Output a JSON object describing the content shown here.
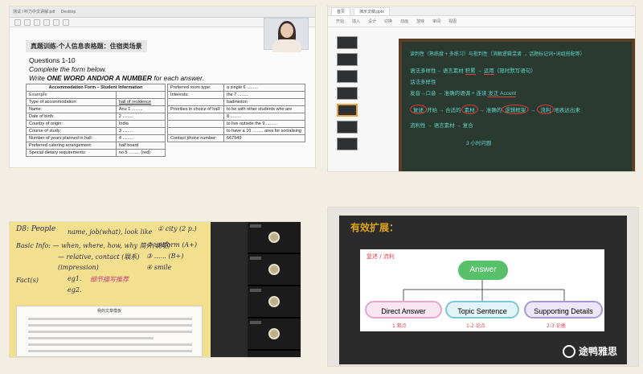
{
  "panel_doc": {
    "tabs": [
      "测试 I 听力中文讲解.pdf",
      "Desktop"
    ],
    "banner": "真题训练-个人信息表格题：住宿类场景",
    "q1": "Questions 1-10",
    "q2": "Complete the form below.",
    "q3_a": "Write ",
    "q3_b": "ONE WORD AND/OR A NUMBER",
    "q3_c": " for each answer.",
    "left_table": {
      "header": "Accommodation Form – Student Information",
      "rows": [
        [
          "Example",
          ""
        ],
        [
          "Type of accommodation:",
          "hall of residence"
        ],
        [
          "Name:",
          "Anu 1 ........."
        ],
        [
          "Date of birth:",
          "2 ........."
        ],
        [
          "Country of origin:",
          "India"
        ],
        [
          "Course of study:",
          "3 ........."
        ],
        [
          "Number of years planned in hall:",
          "4 ........."
        ],
        [
          "Preferred catering arrangement:",
          "half board"
        ],
        [
          "Special dietary requirements:",
          "no 5 ......... (red)"
        ]
      ]
    },
    "right_table": {
      "rows": [
        [
          "Preferred room type:",
          "a single 6 ........."
        ],
        [
          "Interests:",
          "the 7 ........."
        ],
        [
          "",
          "badminton"
        ],
        [
          "Priorities in choice of hall:",
          "to be with other students who are"
        ],
        [
          "",
          "8 ........."
        ],
        [
          "",
          "to live outside the 9 ........."
        ],
        [
          "",
          "to have a 10 ......... area for socialising"
        ],
        [
          "Contact   phone number:",
          "667549"
        ]
      ]
    }
  },
  "panel_slides": {
    "tabs": [
      "首页",
      "演示文稿.pptx"
    ],
    "ribbon": [
      "开始",
      "插入",
      "设计",
      "切换",
      "动画",
      "放映",
      "审阅",
      "视图"
    ],
    "lines": {
      "l1": "读判性（熟练度 + 多练习）与批判性（消解逻辑混淆 → 话题标记词+词组搭配等）",
      "l2a": "语法多样性",
      "l2b": "→ 语言素材 ",
      "l2c": "积累",
      "l2d": " → ",
      "l2e": "运用",
      "l2f": "（限时默写语句）",
      "l3": "话法多样性",
      "l4a": "发音→口音 → 准确的语调 + 连读",
      "l4b": " 发正 Accent",
      "c1": "复述",
      "c2": "开始 → 合适的",
      "c3": "素材",
      "c4": " → 准确的",
      "c5": "逻辑框架",
      "c6": " → ",
      "c7": "流利",
      "c8": "地表达出来",
      "l6": "流利性 → 语言素材 → 复合",
      "l7": "3 小时问题"
    }
  },
  "panel_notes": {
    "lines": {
      "a": "D8: People",
      "b": "name, job(what), look like",
      "c": "Basic Info: — when, where, how, why 简介(说明)",
      "d": "— relative, contact (联系)",
      "e": "(impression)",
      "f": "Fact(s)",
      "g": "eg1.",
      "h": "细节描写推荐",
      "i": "eg2.",
      "r1": "① city (2 p.)",
      "r2": "② uniform (A+)",
      "r3": "③ ...... (B+)",
      "r4": "④ smile"
    },
    "paper_title": "我的文章模板"
  },
  "panel_map": {
    "title": "有效扩展：",
    "scribble": "复述 / 流利",
    "root": "Answer",
    "nodes": [
      "Direct Answer",
      "Topic Sentence",
      "Supporting Details"
    ],
    "notes": [
      "1 观点",
      "1-2  论点",
      "2-3  论据"
    ],
    "logo": "途鸭雅思"
  }
}
